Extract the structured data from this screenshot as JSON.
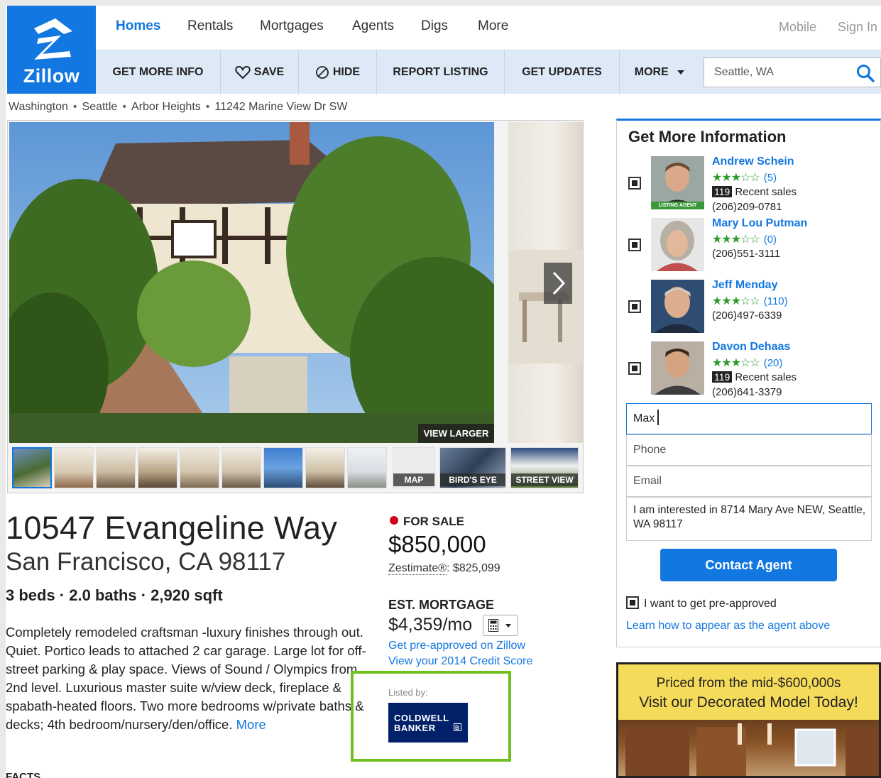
{
  "brand": {
    "name": "Zillow",
    "color": "#1277e1"
  },
  "topnav": {
    "items": [
      "Homes",
      "Rentals",
      "Mortgages",
      "Agents",
      "Digs",
      "More"
    ],
    "right": [
      "Mobile",
      "Sign In"
    ]
  },
  "subnav": {
    "items": [
      "GET MORE INFO",
      "SAVE",
      "HIDE",
      "REPORT LISTING",
      "GET UPDATES",
      "MORE"
    ],
    "search_value": "Seattle, WA"
  },
  "breadcrumb": [
    "Washington",
    "Seattle",
    "Arbor Heights",
    "11242 Marine View Dr SW"
  ],
  "gallery": {
    "view_larger": "VIEW LARGER",
    "thumb_labels": {
      "map": "MAP",
      "birds_eye": "BIRD'S EYE",
      "street_view": "STREET VIEW"
    }
  },
  "listing": {
    "street": "10547 Evangeline Way",
    "city": "San Francisco, CA 98117",
    "facts": "3 beds · 2.0 baths · 2,920 sqft",
    "description": "Completely remodeled craftsman -luxury finishes through out. Quiet. Portico leads to attached 2 car garage. Large lot for off-street parking & play space. Views of Sound / Olympics from 2nd level. Luxurious master suite w/view deck, fireplace & spabath-heated floors. Two more bedrooms w/private baths & decks; 4th bedroom/nursery/den/office.",
    "more_link": "More",
    "facts_heading": "FACTS",
    "status": "FOR SALE",
    "status_color": "#d0021b",
    "price": "$850,000",
    "zestimate_label": "Zestimate®",
    "zestimate_value": ": $825,099",
    "mortgage_heading": "EST. MORTGAGE",
    "mortgage_value": "$4,359/mo",
    "preapproved_link": "Get pre-approved on Zillow",
    "credit_link": "View your 2014 Credit Score",
    "listed_by": "Listed by:",
    "broker_line1": "COLDWELL",
    "broker_line2": "BANKER",
    "highlight_color": "#6fbf1e"
  },
  "contact": {
    "title": "Get More Information",
    "agents": [
      {
        "name": "Andrew Schein",
        "stars": "★★★☆☆",
        "count": "(5)",
        "sales_badge": "119",
        "sales_text": "Recent sales",
        "phone": "(206)209-0781",
        "tag": "LISTING AGENT"
      },
      {
        "name": "Mary Lou Putman",
        "stars": "★★★☆☆",
        "count": "(0)",
        "phone": "(206)551-3111"
      },
      {
        "name": "Jeff Menday",
        "stars": "★★★☆☆",
        "count": "(110)",
        "phone": "(206)497-6339"
      },
      {
        "name": "Davon Dehaas",
        "stars": "★★★☆☆",
        "count": "(20)",
        "sales_badge": "119",
        "sales_text": "Recent sales",
        "phone": "(206)641-3379"
      }
    ],
    "name_value": "Max",
    "phone_placeholder": "Phone",
    "email_placeholder": "Email",
    "message": "I am interested in 8714 Mary Ave NEW, Seattle, WA 98117",
    "button": "Contact Agent",
    "preapproved_check": "I want to get pre-approved",
    "learn_link": "Learn how to appear as the agent above"
  },
  "ad": {
    "line1": "Priced from the mid-$600,000s",
    "line2": "Visit our Decorated Model Today!"
  }
}
